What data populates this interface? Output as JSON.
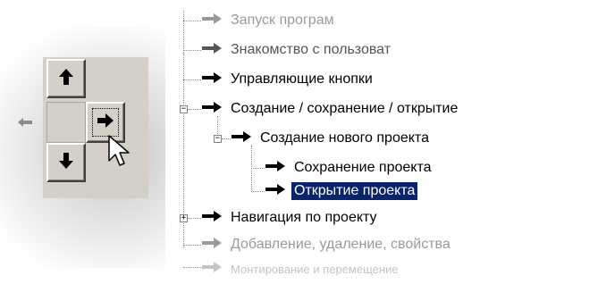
{
  "tree": {
    "items": [
      {
        "label": "Запуск програм",
        "state": "faded",
        "icon": "arrow-right-icon"
      },
      {
        "label": "Знакомство с пользоват",
        "state": "faded",
        "icon": "arrow-right-icon"
      },
      {
        "label": "Управляющие кнопки",
        "state": "normal",
        "icon": "arrow-right-icon"
      },
      {
        "label": "Создание / сохранение / открытие",
        "state": "normal",
        "icon": "arrow-right-icon",
        "expander": "minus"
      },
      {
        "label": "Создание нового проекта",
        "state": "normal",
        "icon": "arrow-right-icon",
        "expander": "minus"
      },
      {
        "label": "Сохранение проекта",
        "state": "normal",
        "icon": "arrow-right-icon"
      },
      {
        "label": "Открытие проекта",
        "state": "selected",
        "icon": "arrow-right-icon"
      },
      {
        "label": "Навигация по проекту",
        "state": "normal",
        "icon": "arrow-right-icon",
        "expander": "plus"
      },
      {
        "label": "Добавление, удаление, свойства",
        "state": "faded",
        "icon": "arrow-right-icon"
      },
      {
        "label": "Монтирование и перемещение",
        "state": "faded2",
        "icon": "arrow-right-icon"
      }
    ]
  },
  "pad": {
    "buttons": [
      "arrow-up-icon",
      "arrow-down-icon",
      "arrow-right-icon"
    ],
    "pointer": "mouse-cursor-icon"
  },
  "colors": {
    "selection": "#0a246a",
    "button_face": "#d4d0c8",
    "faded_text": "#9a9a9a"
  }
}
